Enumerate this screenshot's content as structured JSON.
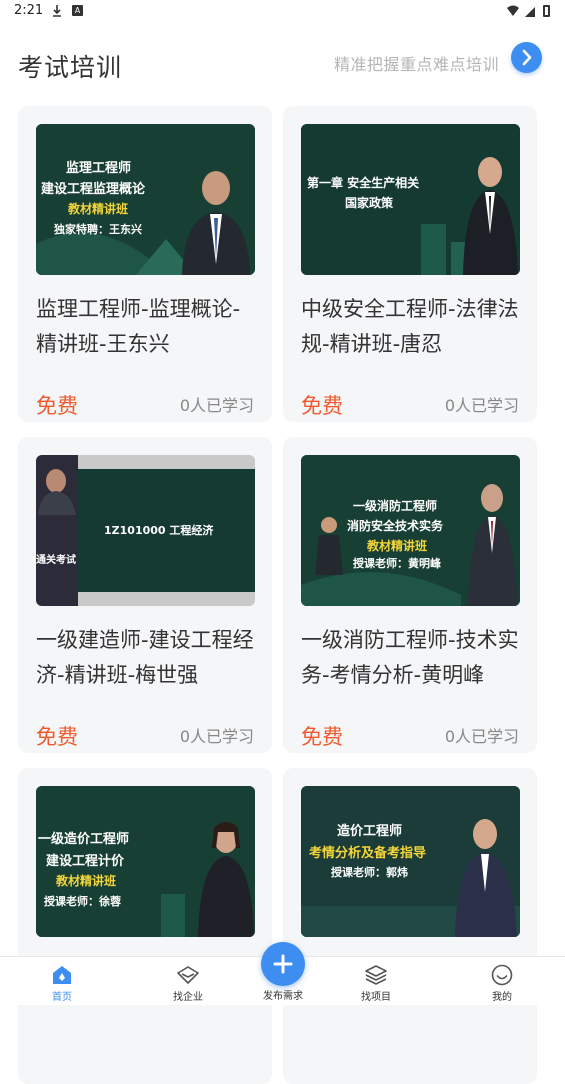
{
  "status_bar": {
    "time": "2:21",
    "notif_letter": "A"
  },
  "header": {
    "title": "考试培训",
    "hint": "精准把握重点难点培训"
  },
  "courses": [
    {
      "title": "监理工程师-监理概论-精讲班-王东兴",
      "price": "免费",
      "learners": "0人已学习",
      "thumb_lines": [
        "监理工程师",
        "建设工程监理概论",
        "教材精讲班",
        "独家特聘：王东兴"
      ]
    },
    {
      "title": "中级安全工程师-法律法规-精讲班-唐忍",
      "price": "免费",
      "learners": "0人已学习",
      "thumb_lines": [
        "第一章  安全生产相关",
        "国家政策"
      ]
    },
    {
      "title": "一级建造师-建设工程经济-精讲班-梅世强",
      "price": "免费",
      "learners": "0人已学习",
      "thumb_lines": [
        "1Z101000  工程经济",
        "通关考试"
      ]
    },
    {
      "title": "一级消防工程师-技术实务-考情分析-黄明峰",
      "price": "免费",
      "learners": "0人已学习",
      "thumb_lines": [
        "一级消防工程师",
        "消防安全技术实务",
        "教材精讲班",
        "授课老师：黄明峰"
      ]
    },
    {
      "title": "",
      "price": "",
      "learners": "",
      "thumb_lines": [
        "一级造价工程师",
        "建设工程计价",
        "教材精讲班",
        "授课老师：徐蓉"
      ]
    },
    {
      "title": "",
      "price": "",
      "learners": "",
      "thumb_lines": [
        "造价工程师",
        "考情分析及备考指导",
        "授课老师：郭炜"
      ]
    }
  ],
  "bottom_nav": {
    "home": "首页",
    "company": "找企业",
    "publish": "发布需求",
    "project": "找项目",
    "mine": "我的"
  },
  "colors": {
    "accent": "#3d8ef0",
    "price": "#ef5a2f",
    "thumb_bg": "#14382f",
    "thumb_highlight": "#f3d43a"
  }
}
